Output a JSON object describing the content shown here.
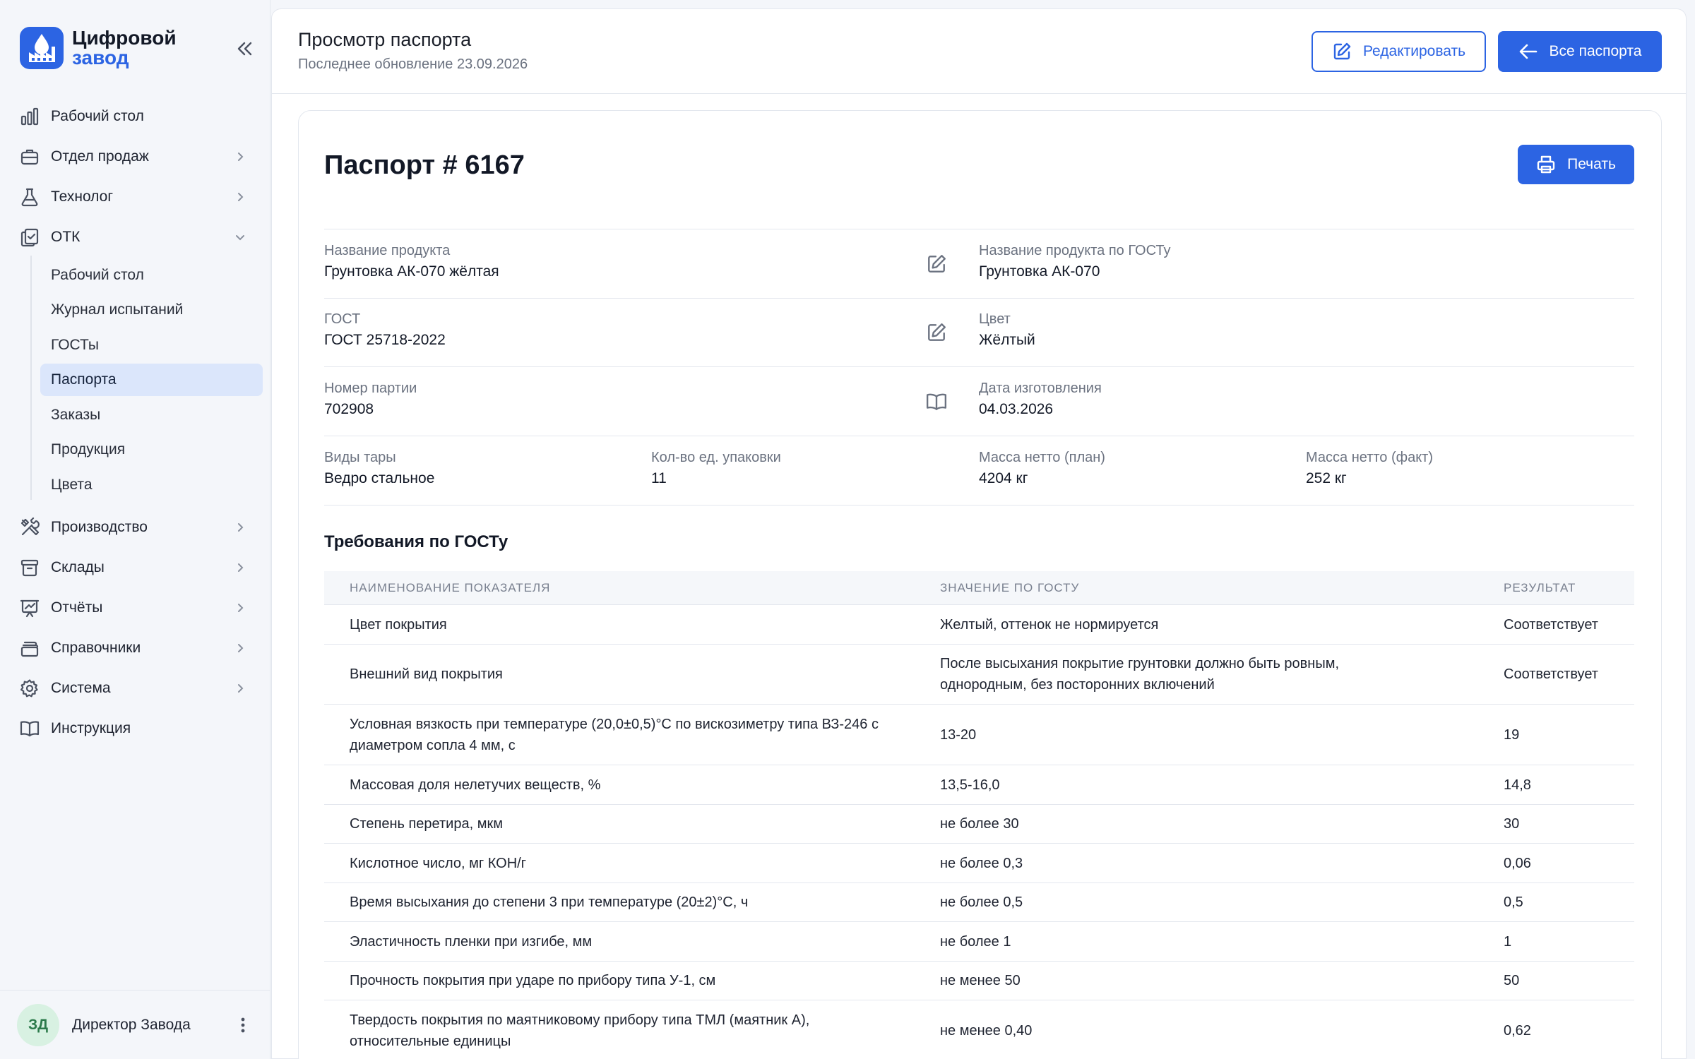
{
  "brand": {
    "line1": "Цифровой",
    "line2": "завод"
  },
  "sidebar": {
    "items": [
      {
        "label": "Рабочий стол",
        "icon": "bar-chart-icon"
      },
      {
        "label": "Отдел продаж",
        "icon": "briefcase-icon",
        "chevron": "right"
      },
      {
        "label": "Технолог",
        "icon": "flask-icon",
        "chevron": "right"
      },
      {
        "label": "ОТК",
        "icon": "clipboard-check-icon",
        "chevron": "down"
      },
      {
        "label": "Производство",
        "icon": "tools-icon",
        "chevron": "right"
      },
      {
        "label": "Склады",
        "icon": "archive-box-icon",
        "chevron": "right"
      },
      {
        "label": "Отчёты",
        "icon": "presentation-chart-icon",
        "chevron": "right"
      },
      {
        "label": "Справочники",
        "icon": "folder-icon",
        "chevron": "right"
      },
      {
        "label": "Система",
        "icon": "gear-icon",
        "chevron": "right"
      },
      {
        "label": "Инструкция",
        "icon": "book-icon"
      }
    ],
    "sub_items": [
      "Рабочий стол",
      "Журнал испытаний",
      "ГОСТы",
      "Паспорта",
      "Заказы",
      "Продукция",
      "Цвета"
    ],
    "active_sub": "Паспорта"
  },
  "user": {
    "initials": "ЗД",
    "name": "Директор Завода"
  },
  "header": {
    "title": "Просмотр паспорта",
    "subtitle": "Последнее обновление 23.09.2026",
    "edit_label": "Редактировать",
    "all_label": "Все паспорта"
  },
  "passport": {
    "title": "Паспорт # 6167",
    "print_label": "Печать",
    "product_name_label": "Название продукта",
    "product_name": "Грунтовка АК-070 жёлтая",
    "gost_name_label": "Название продукта по ГОСТу",
    "gost_name": "Грунтовка АК-070",
    "gost_label": "ГОСТ",
    "gost": "ГОСТ 25718-2022",
    "color_label": "Цвет",
    "color": "Жёлтый",
    "batch_label": "Номер партии",
    "batch": "702908",
    "date_label": "Дата изготовления",
    "date": "04.03.2026",
    "container_label": "Виды тары",
    "container": "Ведро стальное",
    "pack_count_label": "Кол-во ед. упаковки",
    "pack_count": "11",
    "mass_plan_label": "Масса нетто (план)",
    "mass_plan": "4204 кг",
    "mass_fact_label": "Масса нетто (факт)",
    "mass_fact": "252 кг"
  },
  "requirements": {
    "title": "Требования по ГОСТу",
    "columns": [
      "НАИМЕНОВАНИЕ ПОКАЗАТЕЛЯ",
      "ЗНАЧЕНИЕ ПО ГОСТУ",
      "РЕЗУЛЬТАТ"
    ],
    "rows": [
      [
        "Цвет покрытия",
        "Желтый, оттенок не нормируется",
        "Соответствует"
      ],
      [
        "Внешний вид покрытия",
        "После высыхания покрытие грунтовки должно быть ровным, однородным, без посторонних включений",
        "Соответствует"
      ],
      [
        "Условная вязкость при температуре (20,0±0,5)°С по вискозиметру типа ВЗ-246 с диаметром сопла 4 мм, с",
        "13-20",
        "19"
      ],
      [
        "Массовая доля нелетучих веществ, %",
        "13,5-16,0",
        "14,8"
      ],
      [
        "Степень перетира, мкм",
        "не более 30",
        "30"
      ],
      [
        "Кислотное число, мг КОН/г",
        "не более 0,3",
        "0,06"
      ],
      [
        "Время высыхания до степени 3 при температуре (20±2)°С, ч",
        "не более 0,5",
        "0,5"
      ],
      [
        "Эластичность пленки при изгибе, мм",
        "не более 1",
        "1"
      ],
      [
        "Прочность покрытия при ударе по прибору типа У-1, см",
        "не менее 50",
        "50"
      ],
      [
        "Твердость покрытия по маятниковому прибору типа ТМЛ (маятник А), относительные единицы",
        "не менее 0,40",
        "0,62"
      ]
    ]
  },
  "colors": {
    "accent": "#2c64e3",
    "active_bg": "#dbe6fb"
  }
}
